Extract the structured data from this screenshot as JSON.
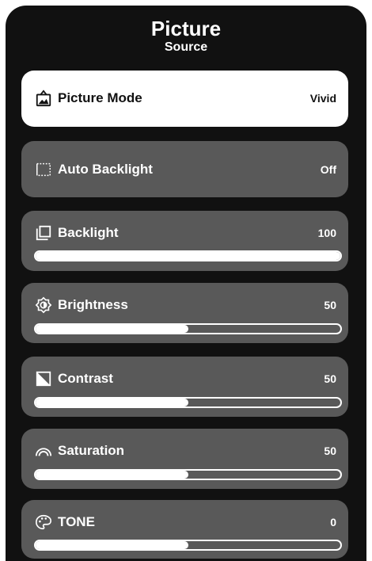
{
  "header": {
    "title": "Picture",
    "subtitle": "Source"
  },
  "items": [
    {
      "label": "Picture Mode",
      "value": "Vivid",
      "icon": "picture-mode-icon",
      "selected": true
    },
    {
      "label": "Auto Backlight",
      "value": "Off",
      "icon": "auto-backlight-icon"
    },
    {
      "label": "Backlight",
      "value": "100",
      "icon": "backlight-icon",
      "level_percent": 100
    },
    {
      "label": "Brightness",
      "value": "50",
      "icon": "brightness-icon",
      "level_percent": 50
    },
    {
      "label": "Contrast",
      "value": "50",
      "icon": "contrast-icon",
      "level_percent": 50
    },
    {
      "label": "Saturation",
      "value": "50",
      "icon": "saturation-icon",
      "level_percent": 50
    },
    {
      "label": "TONE",
      "value": "0",
      "icon": "tone-icon",
      "level_percent": 50
    }
  ],
  "colors": {
    "panel": "#111111",
    "item": "#595959",
    "selected": "#ffffff",
    "text": "#ffffff"
  }
}
